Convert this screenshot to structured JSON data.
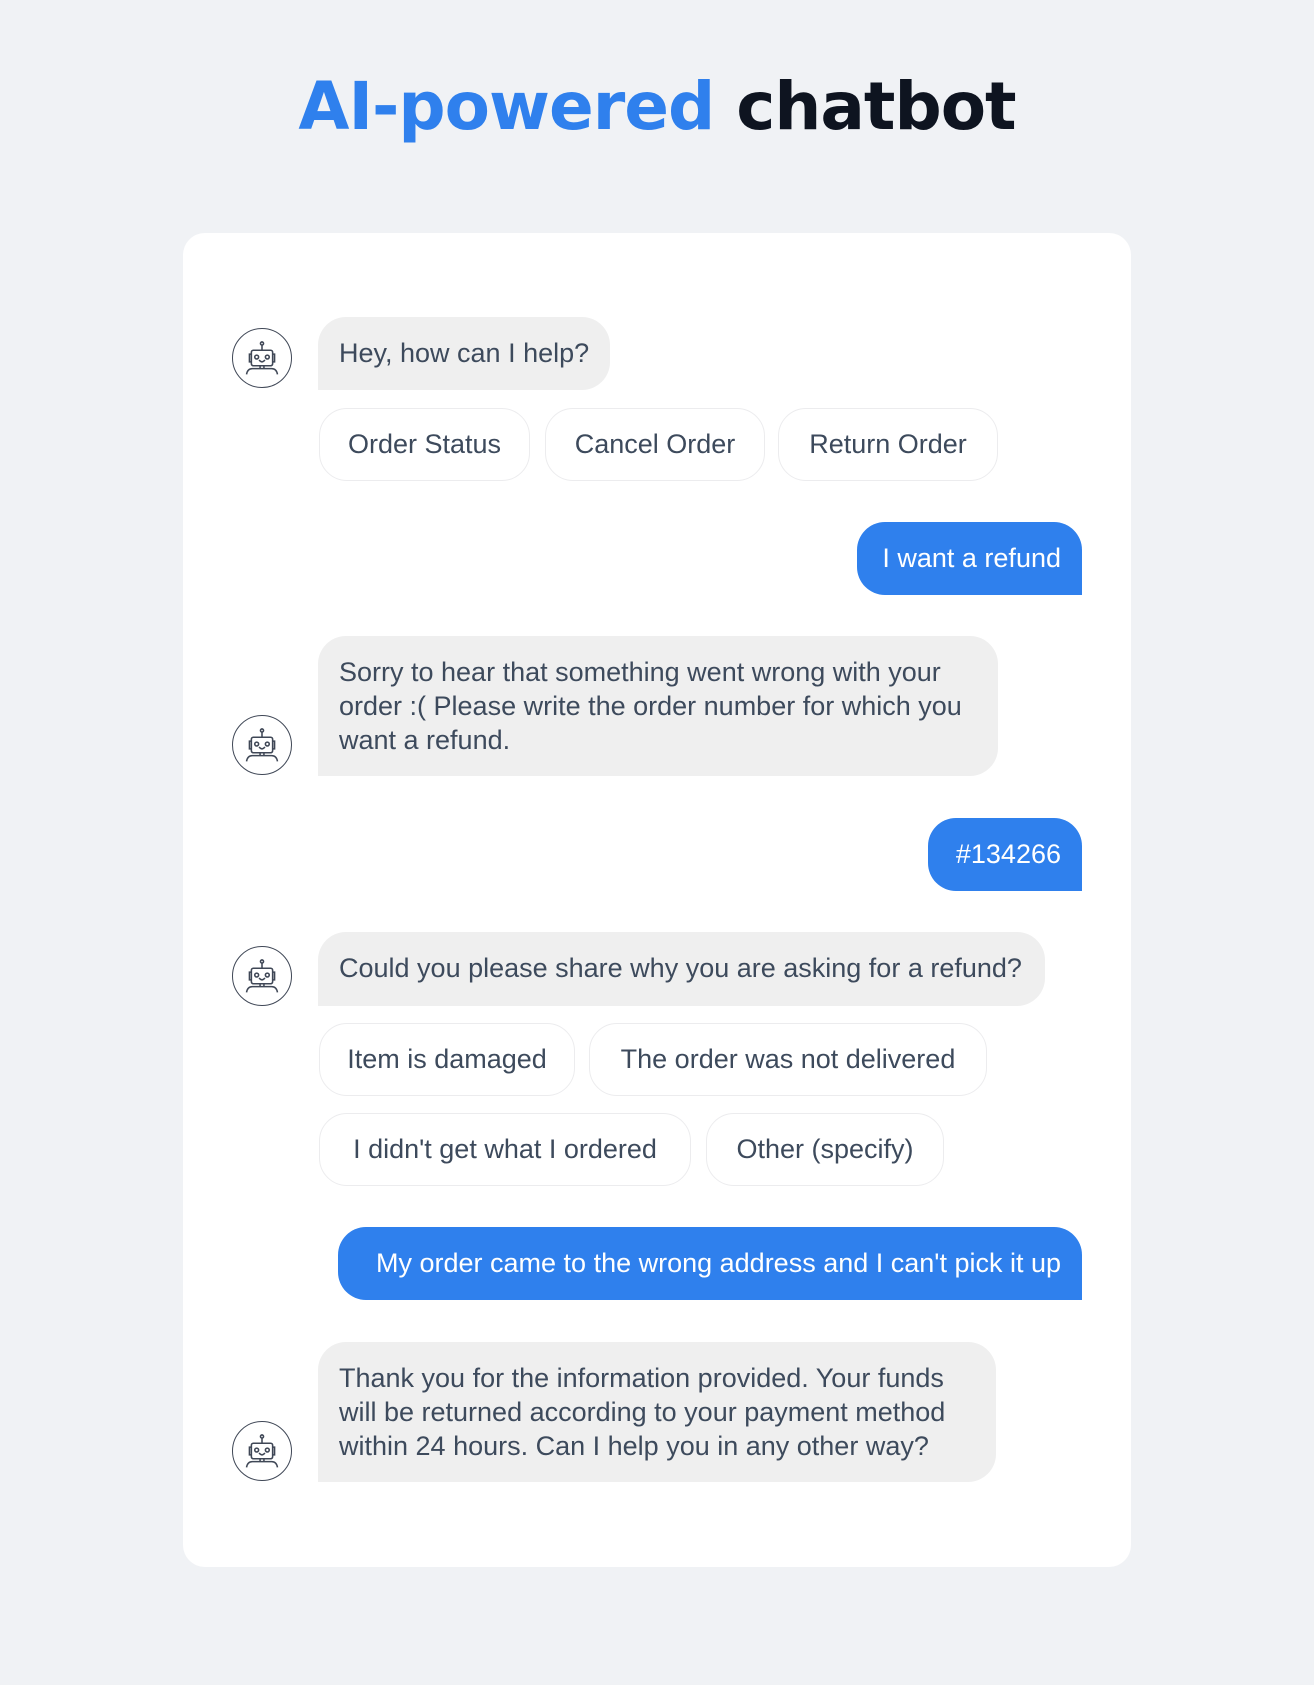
{
  "header": {
    "title_accent": "AI-powered",
    "title_rest": "chatbot",
    "accent_color": "#2f80ed"
  },
  "chat": {
    "messages": [
      {
        "sender": "bot",
        "lines": [
          "Hey, how can I help?"
        ],
        "quick_replies": [
          "Order Status",
          "Cancel Order",
          "Return Order"
        ]
      },
      {
        "sender": "user",
        "lines": [
          "I want a refund"
        ]
      },
      {
        "sender": "bot",
        "lines": [
          "Sorry to hear that something went wrong with your",
          "order :( Please write the order number for which you",
          "want a refund."
        ]
      },
      {
        "sender": "user",
        "lines": [
          "#134266"
        ]
      },
      {
        "sender": "bot",
        "lines": [
          "Could you please share why you are asking for a refund?"
        ],
        "quick_replies": [
          "Item is damaged",
          "The order was not delivered",
          "I didn't get what I ordered",
          "Other (specify)"
        ]
      },
      {
        "sender": "user",
        "lines": [
          "My order came to the wrong address and I can't pick it up"
        ]
      },
      {
        "sender": "bot",
        "lines": [
          "Thank you for the information provided. Your funds",
          "will be returned according to your payment method",
          "within 24 hours. Can I help you in any other way?"
        ]
      }
    ],
    "avatar_icon": "robot-icon",
    "colors": {
      "user_bubble": "#2f80ed",
      "bot_bubble": "#efefef",
      "text": "#3d4a5c"
    }
  }
}
